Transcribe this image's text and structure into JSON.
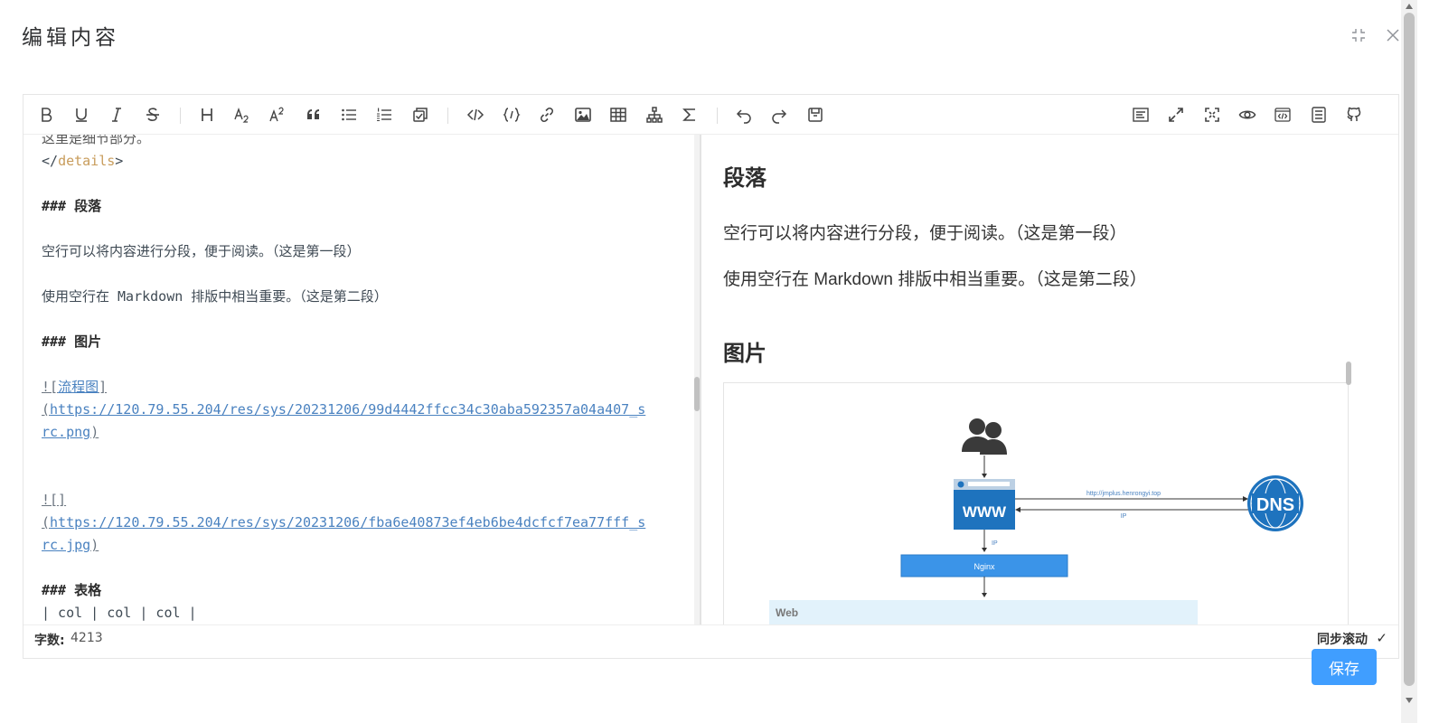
{
  "dialog": {
    "title": "编辑内容"
  },
  "toolbar": {
    "left": [
      "bold-icon",
      "underline-icon",
      "italic-icon",
      "strikethrough-icon",
      "heading-icon",
      "subscript-icon",
      "superscript-icon",
      "quote-icon",
      "unordered-list-icon",
      "ordered-list-icon",
      "task-list-icon",
      "inline-code-icon",
      "code-block-icon",
      "link-icon",
      "image-icon",
      "table-icon",
      "mindmap-icon",
      "formula-icon",
      "undo-icon",
      "redo-icon",
      "save-draft-icon"
    ],
    "right": [
      "preview-only-icon",
      "fullscreen-icon",
      "page-fullscreen-icon",
      "preview-icon",
      "html-preview-icon",
      "catalog-icon",
      "github-icon"
    ]
  },
  "source": {
    "l1": "这里是细节部分。",
    "l2_open": "</",
    "l2_tag": "details",
    "l2_close": ">",
    "l3": "### 段落",
    "l4": "空行可以将内容进行分段，便于阅读。（这是第一段）",
    "l5": "使用空行在 Markdown 排版中相当重要。（这是第二段）",
    "l6": "### 图片",
    "img1_open": "![",
    "img1_alt": "流程图",
    "img1_close": "]",
    "img1_p": "(",
    "img1_url_a": "https://120.79.55.204/res/sys/20231206/99d4442ffcc34c30aba592357a04a407_s",
    "img1_url_b": "rc.png",
    "img1_pc": ")",
    "img2_brackets": "![]",
    "img2_p": "(",
    "img2_url_a": "https://120.79.55.204/res/sys/20231206/fba6e40873ef4eb6be4dcfcf7ea77fff_s",
    "img2_url_b": "rc.jpg",
    "img2_pc": ")",
    "l7": "### 表格",
    "l8": "| col | col | col |",
    "l9": "|-----|-----|-----|"
  },
  "preview": {
    "h_paragraph": "段落",
    "p1": "空行可以将内容进行分段，便于阅读。（这是第一段）",
    "p2": "使用空行在 Markdown 排版中相当重要。（这是第二段）",
    "h_image": "图片",
    "diagram": {
      "www": "WWW",
      "dns": "DNS",
      "url": "http://jmplus.henrongyi.top",
      "ip1": "IP",
      "ip2": "IP",
      "nginx": "Nginx",
      "web": "Web"
    }
  },
  "footer": {
    "word_count_label": "字数:",
    "word_count": "4213",
    "sync_label": "同步滚动",
    "sync_check": "✓"
  },
  "actions": {
    "save": "保存"
  },
  "colors": {
    "accent": "#409eff",
    "tag": "#c89c5b",
    "link": "#4a82c0"
  }
}
